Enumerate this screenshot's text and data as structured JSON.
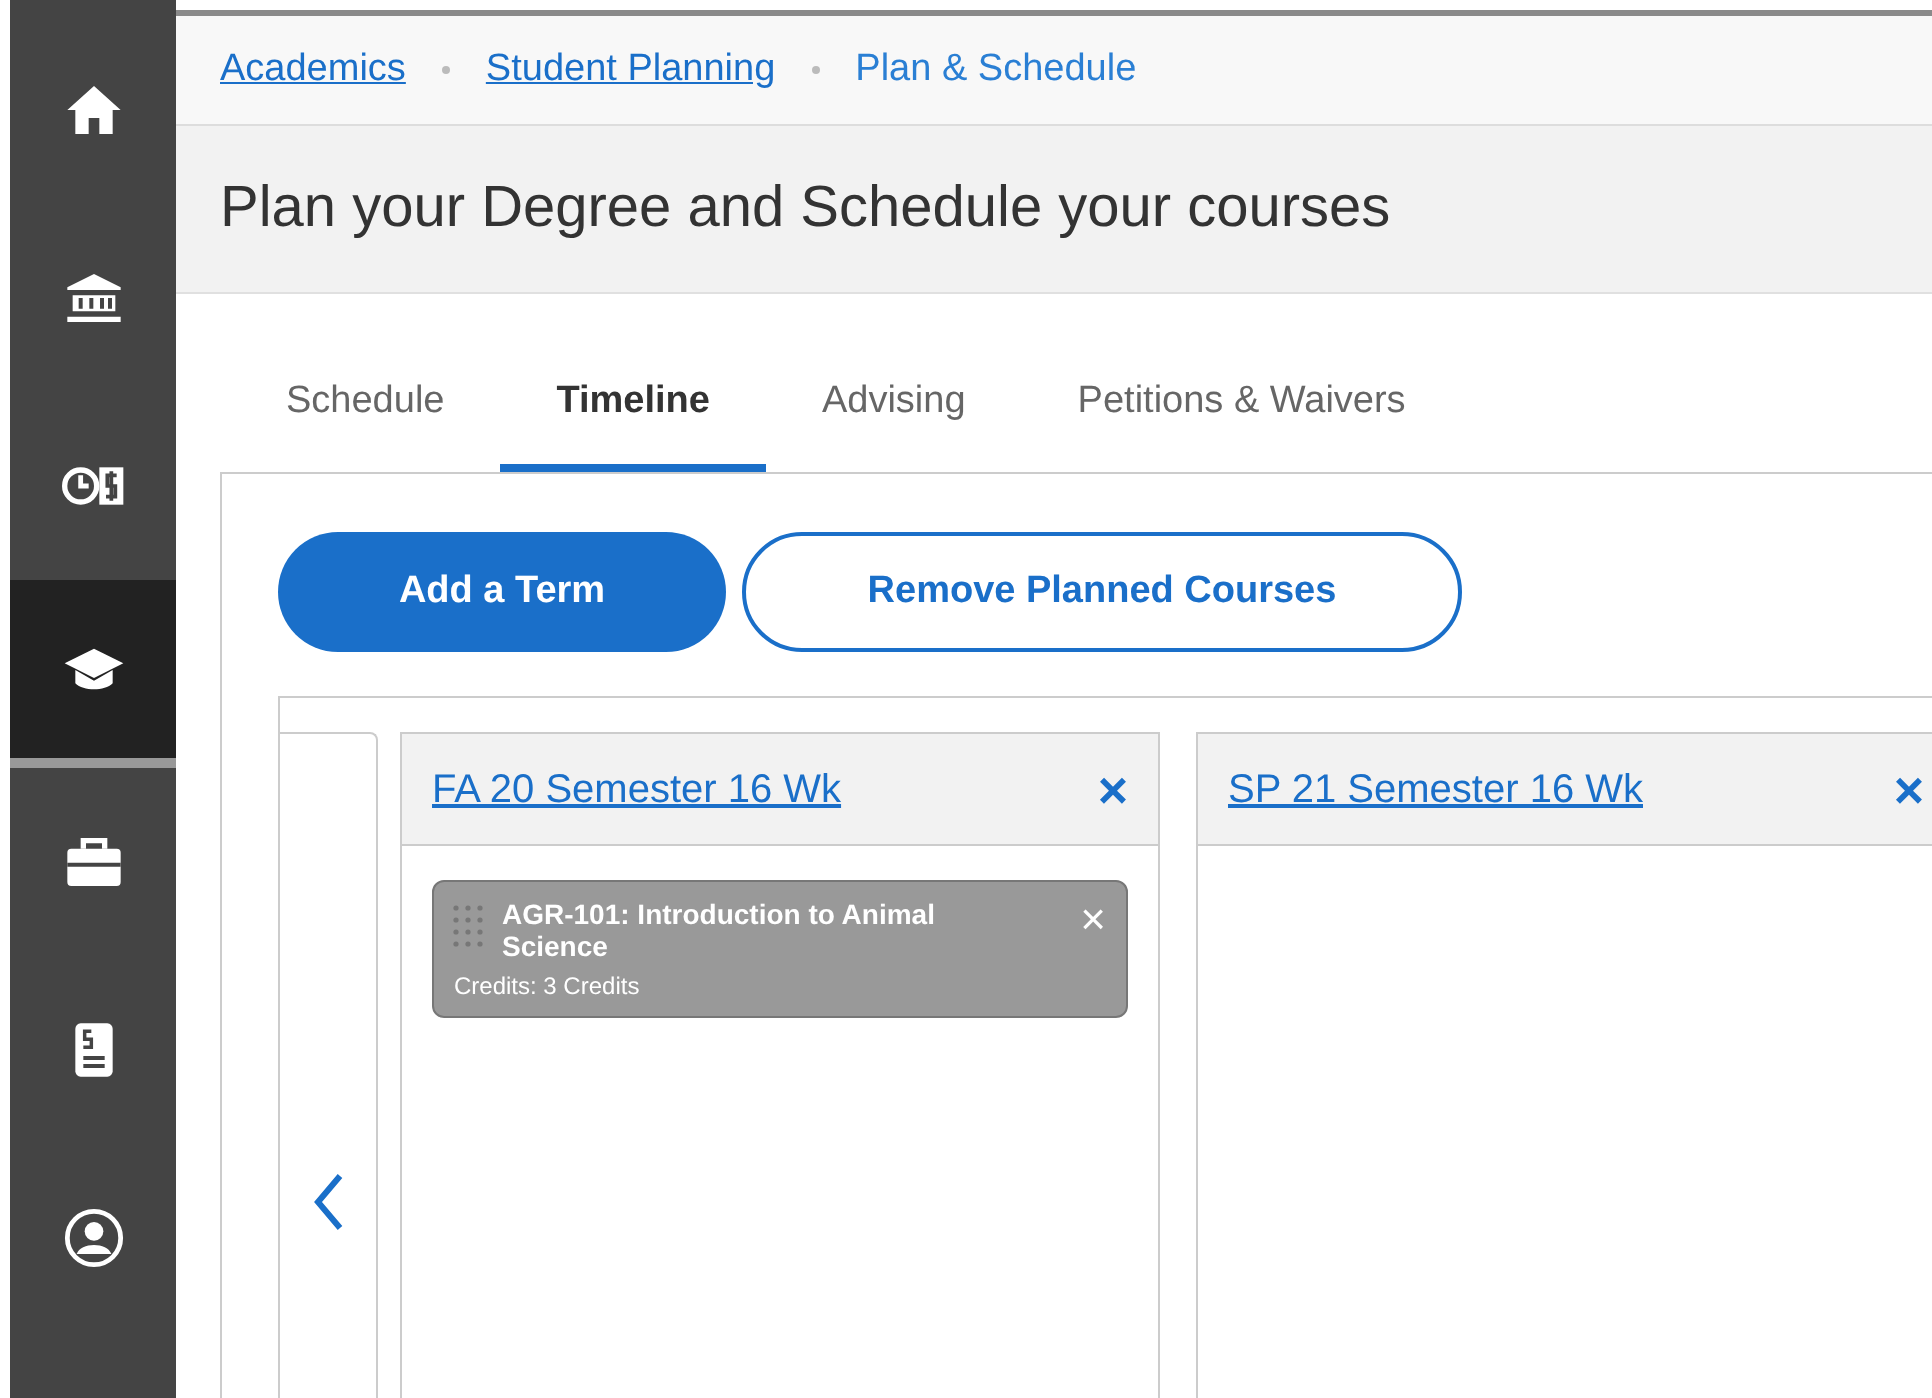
{
  "sidebar": {
    "items": [
      {
        "kind": "home",
        "selected": false
      },
      {
        "kind": "bank",
        "selected": false
      },
      {
        "kind": "finance",
        "selected": false
      },
      {
        "kind": "academics",
        "selected": true
      },
      {
        "kind": "briefcase",
        "selected": false
      },
      {
        "kind": "bill",
        "selected": false
      },
      {
        "kind": "profile",
        "selected": false
      }
    ]
  },
  "breadcrumb": [
    {
      "label": "Academics",
      "link": true
    },
    {
      "label": "Student Planning",
      "link": true
    },
    {
      "label": "Plan & Schedule",
      "link": false
    }
  ],
  "page_title": "Plan your Degree and Schedule your courses",
  "tabs": [
    {
      "label": "Schedule",
      "selected": false
    },
    {
      "label": "Timeline",
      "selected": true
    },
    {
      "label": "Advising",
      "selected": false
    },
    {
      "label": "Petitions & Waivers",
      "selected": false
    }
  ],
  "buttons": [
    {
      "label": "Add a Term",
      "kind": "primary"
    },
    {
      "label": "Remove Planned Courses",
      "kind": "secondary"
    }
  ],
  "terms": [
    {
      "title": "FA 20 Semester 16 Wk",
      "close": "×",
      "courses": [
        {
          "title": "AGR-101: Introduction to Animal Science",
          "credits": "Credits: 3 Credits",
          "close": "×"
        }
      ]
    },
    {
      "title": "SP 21 Semester 16 Wk",
      "close": "×"
    }
  ]
}
